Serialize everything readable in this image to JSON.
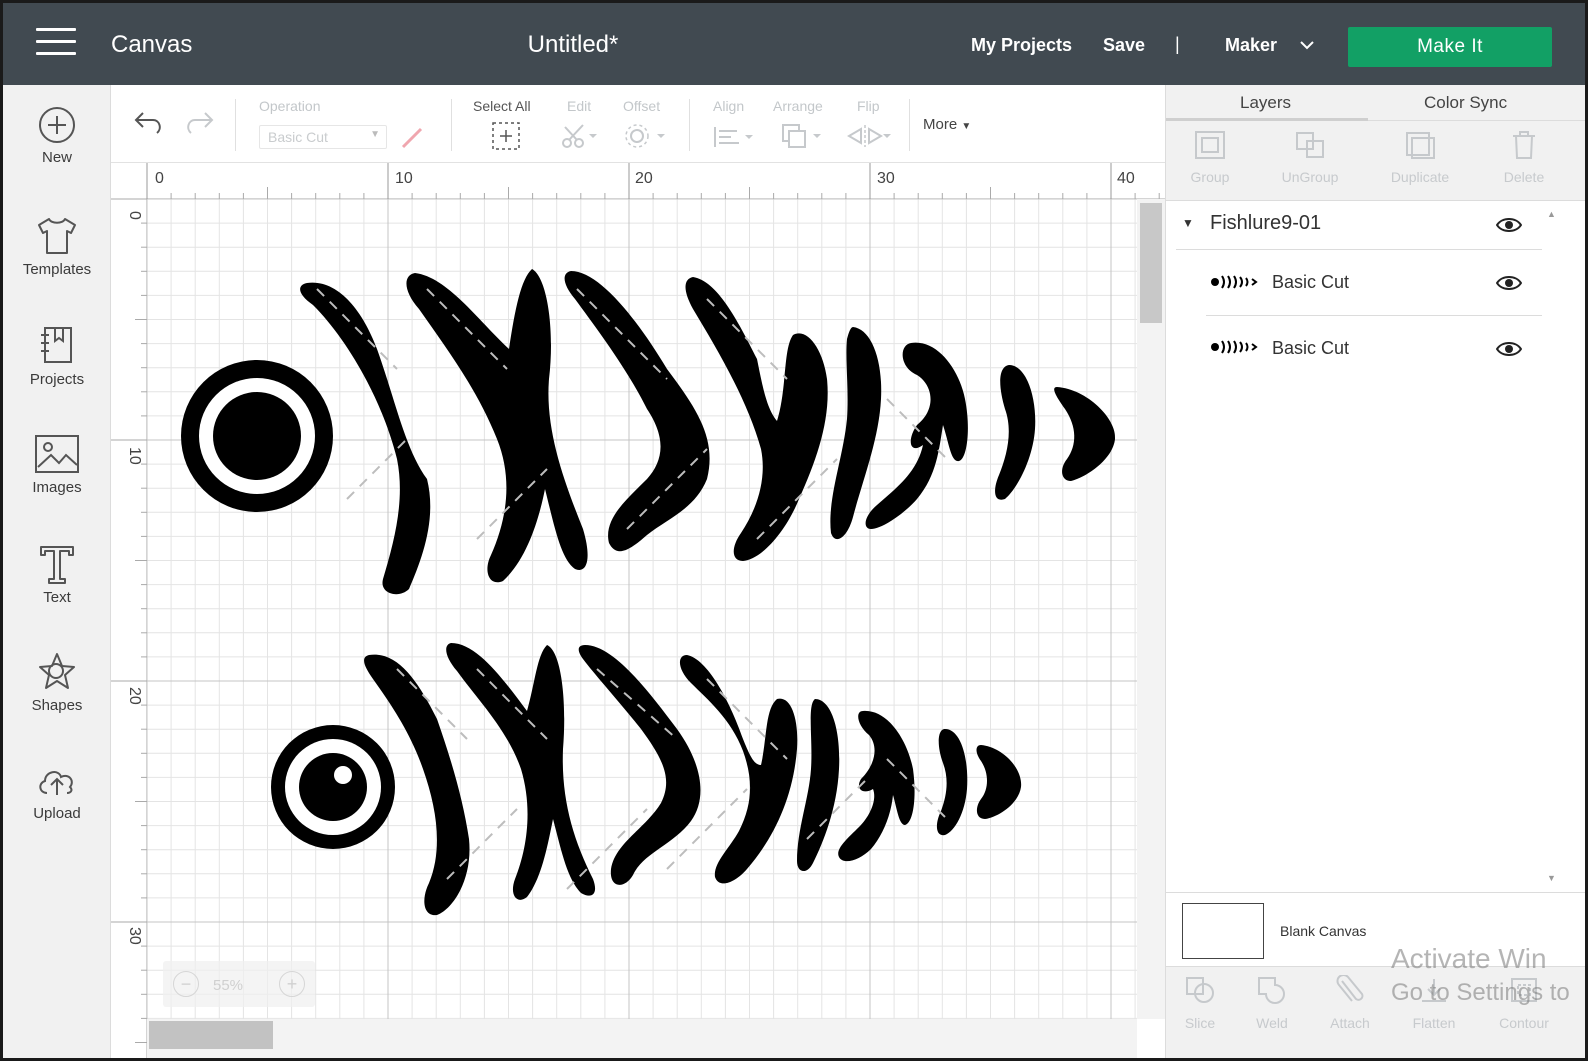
{
  "header": {
    "app_title": "Canvas",
    "doc_title": "Untitled*",
    "my_projects": "My Projects",
    "save": "Save",
    "separator": "|",
    "machine": "Maker",
    "make_it": "Make It"
  },
  "sidebar": {
    "items": [
      {
        "label": "New",
        "icon": "plus-circle-icon"
      },
      {
        "label": "Templates",
        "icon": "tshirt-icon"
      },
      {
        "label": "Projects",
        "icon": "bookmark-icon"
      },
      {
        "label": "Images",
        "icon": "image-icon"
      },
      {
        "label": "Text",
        "icon": "text-t-icon"
      },
      {
        "label": "Shapes",
        "icon": "shapes-icon"
      },
      {
        "label": "Upload",
        "icon": "upload-cloud-icon"
      }
    ]
  },
  "toolbar": {
    "operation_label": "Operation",
    "operation_value": "Basic Cut",
    "select_all": "Select All",
    "edit": "Edit",
    "offset": "Offset",
    "align": "Align",
    "arrange": "Arrange",
    "flip": "Flip",
    "more": "More"
  },
  "rulers": {
    "top_ticks": [
      "0",
      "10",
      "20",
      "30",
      "40"
    ],
    "left_ticks": [
      "0",
      "10",
      "20",
      "30"
    ]
  },
  "zoom": {
    "value": "55%",
    "minus": "−",
    "plus": "+"
  },
  "right_panel": {
    "tabs": [
      "Layers",
      "Color Sync"
    ],
    "actions": [
      "Group",
      "UnGroup",
      "Duplicate",
      "Delete"
    ],
    "group_name": "Fishlure9-01",
    "layers": [
      {
        "name": "Basic Cut"
      },
      {
        "name": "Basic Cut"
      }
    ],
    "canvas_label": "Blank Canvas",
    "bottom_actions": [
      "Slice",
      "Weld",
      "Attach",
      "Flatten",
      "Contour"
    ]
  },
  "watermark": {
    "line1": "Activate Win",
    "line2": "Go to Settings to"
  },
  "colors": {
    "header_bg": "#414a51",
    "make_it": "#12a065",
    "shape_fill": "#000000"
  }
}
